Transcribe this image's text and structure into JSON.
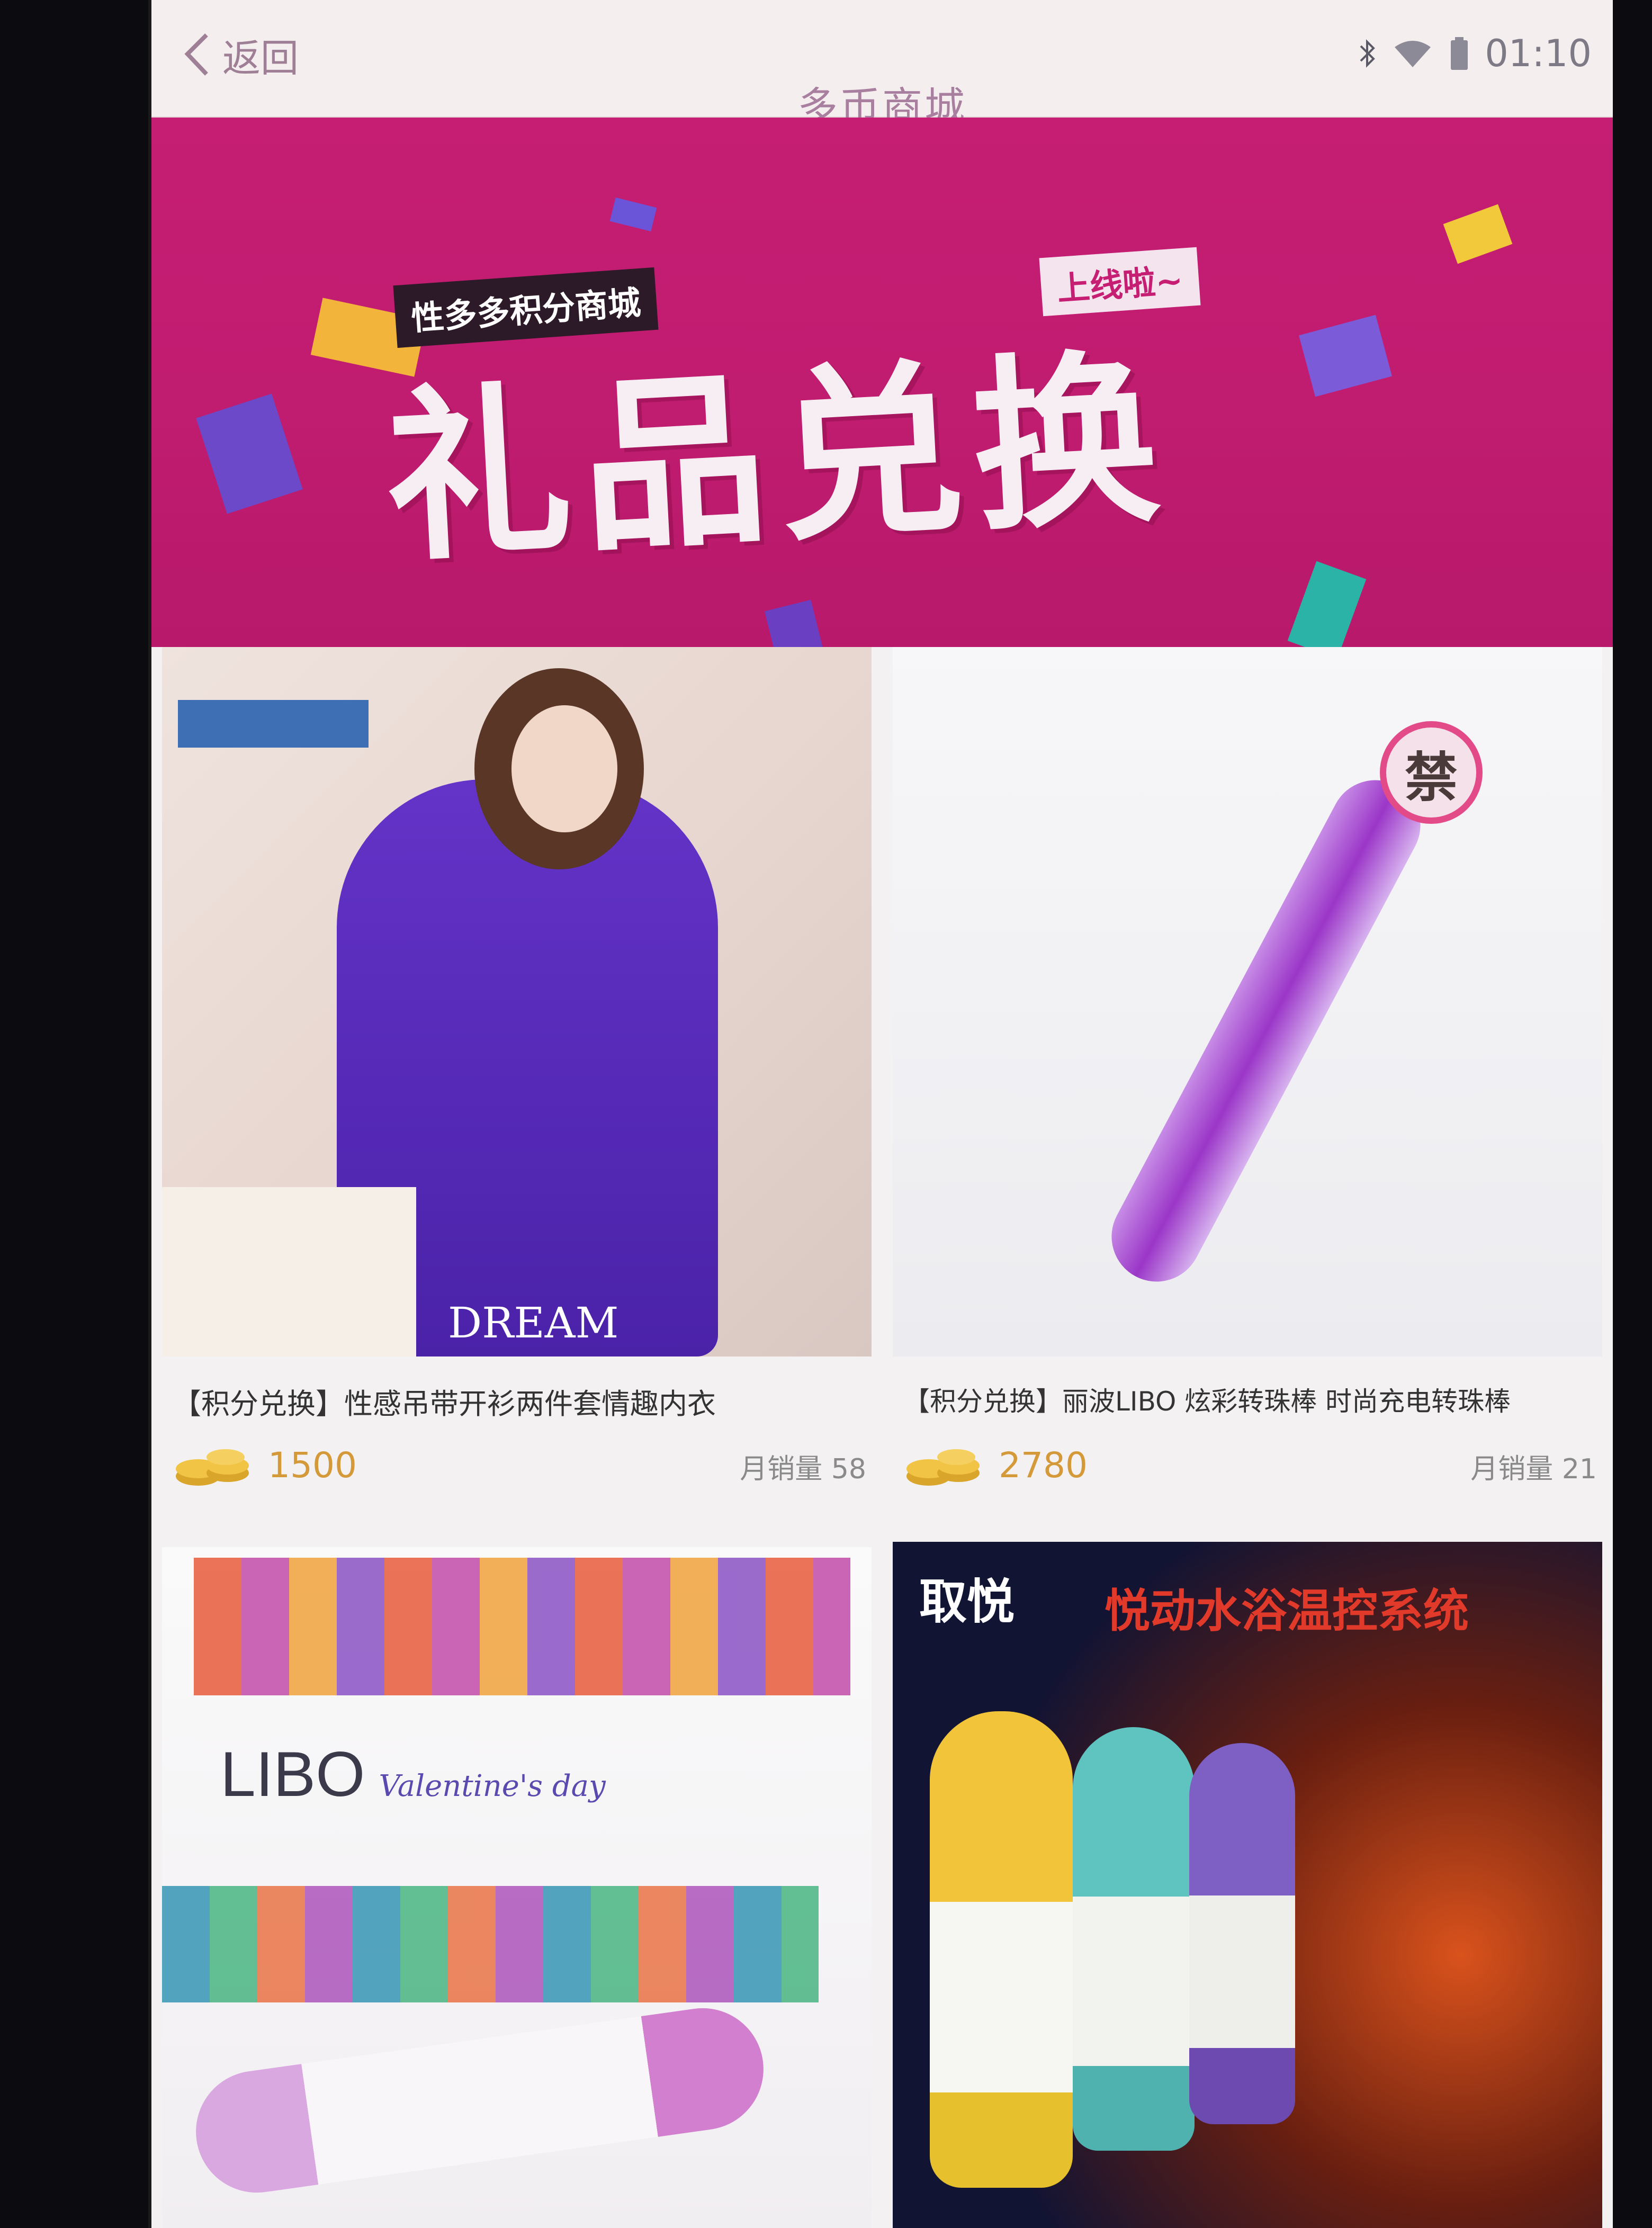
{
  "nav": {
    "back_label": "返回",
    "title": "多币商城",
    "time": "01:10"
  },
  "banner": {
    "tagline": "性多多积分商城",
    "tagline_badge": "上线啦~",
    "headline": "礼品兑换"
  },
  "products": [
    {
      "name": "【积分兑换】性感吊带开衫两件套情趣内衣",
      "price": "1500",
      "sales": "月销量 58",
      "image_text": "DREAM",
      "accent": "#5a2bb8"
    },
    {
      "name": "【积分兑换】丽波LIBO 炫彩转珠棒 时尚充电转珠棒",
      "price": "2780",
      "sales": "月销量 21",
      "image_text": "禁",
      "accent": "#a03cd0"
    },
    {
      "name": "",
      "image_text": "LIBO",
      "image_subtext": "Valentine's day",
      "accent": "#d27fd0"
    },
    {
      "name": "",
      "image_text": "悦动水浴温控系统",
      "image_subtext": "取悦",
      "accent": "#1b1e3c"
    }
  ]
}
